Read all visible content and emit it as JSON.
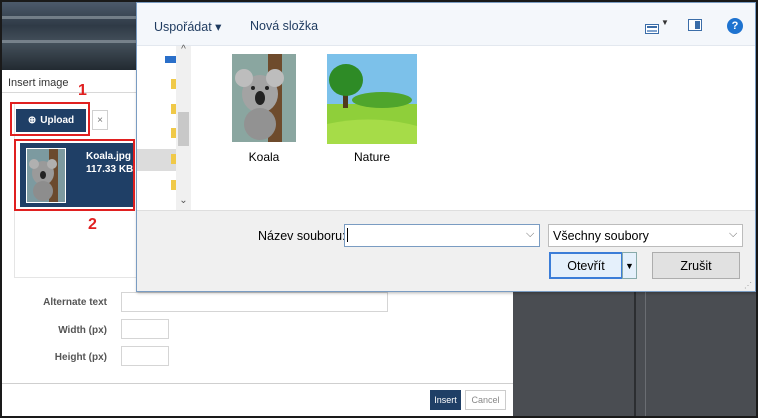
{
  "insert_dialog": {
    "title": "Insert image",
    "upload_label": "Upload",
    "clear_label": "×",
    "file": {
      "name": "Koala.jpg",
      "size": "117.33 KB"
    },
    "fields": {
      "alt_label": "Alternate text",
      "width_label": "Width (px)",
      "height_label": "Height (px)"
    },
    "insert_label": "Insert",
    "cancel_label": "Cancel"
  },
  "annotations": {
    "step1": "1",
    "step2": "2"
  },
  "open_dialog": {
    "toolbar": {
      "organize": "Uspořádat ▾",
      "new_folder": "Nová složka",
      "help": "?"
    },
    "files": [
      {
        "label": "Koala",
        "icon": "koala-image-icon"
      },
      {
        "label": "Nature",
        "icon": "nature-image-icon"
      }
    ],
    "filename_label": "Název souboru:",
    "filename_value": "",
    "filetype_value": "Všechny soubory",
    "open_label": "Otevřít",
    "cancel_label": "Zrušit"
  },
  "colors": {
    "primary": "#1f3f66",
    "highlight": "#e02020",
    "focus": "#3b7dd8"
  }
}
